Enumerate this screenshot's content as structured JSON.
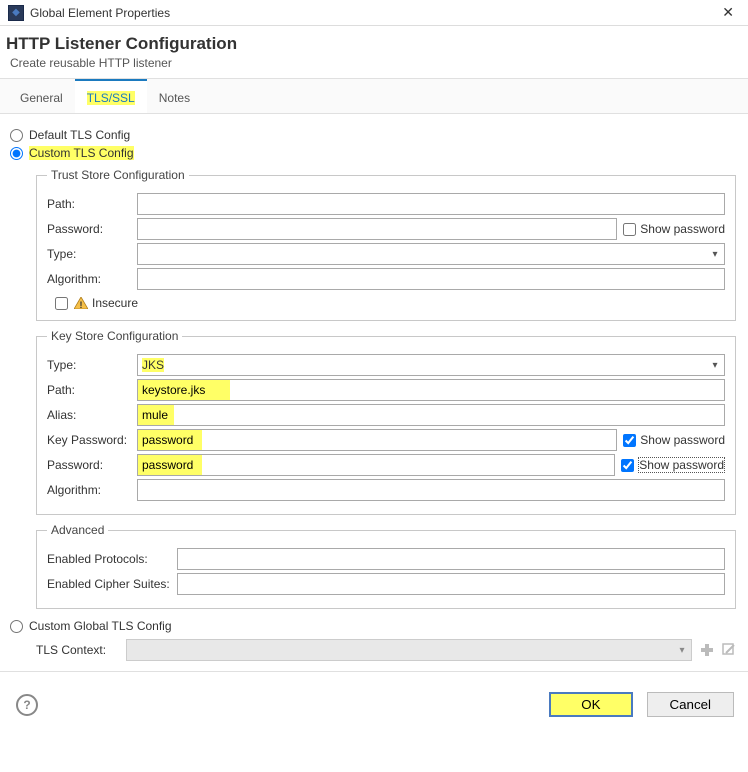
{
  "window": {
    "title": "Global Element Properties"
  },
  "header": {
    "title": "HTTP Listener Configuration",
    "subtitle": "Create reusable HTTP listener"
  },
  "tabs": {
    "general": "General",
    "tls": "TLS/SSL",
    "notes": "Notes"
  },
  "radios": {
    "default": "Default TLS Config",
    "custom": "Custom TLS Config",
    "global": "Custom Global TLS Config"
  },
  "trust": {
    "legend": "Trust Store Configuration",
    "path_label": "Path:",
    "path_value": "",
    "password_label": "Password:",
    "password_value": "",
    "showpw_label": "Show password",
    "type_label": "Type:",
    "type_value": "",
    "algo_label": "Algorithm:",
    "algo_value": "",
    "insecure_label": "Insecure"
  },
  "key": {
    "legend": "Key Store Configuration",
    "type_label": "Type:",
    "type_value": "JKS",
    "path_label": "Path:",
    "path_value": "keystore.jks",
    "alias_label": "Alias:",
    "alias_value": "mule",
    "keypw_label": "Key Password:",
    "keypw_value": "password",
    "pw_label": "Password:",
    "pw_value": "password",
    "algo_label": "Algorithm:",
    "algo_value": "",
    "showpw_label": "Show password"
  },
  "advanced": {
    "legend": "Advanced",
    "protocols_label": "Enabled Protocols:",
    "protocols_value": "",
    "ciphers_label": "Enabled Cipher Suites:",
    "ciphers_value": ""
  },
  "context": {
    "label": "TLS Context:",
    "value": ""
  },
  "buttons": {
    "ok": "OK",
    "cancel": "Cancel"
  }
}
